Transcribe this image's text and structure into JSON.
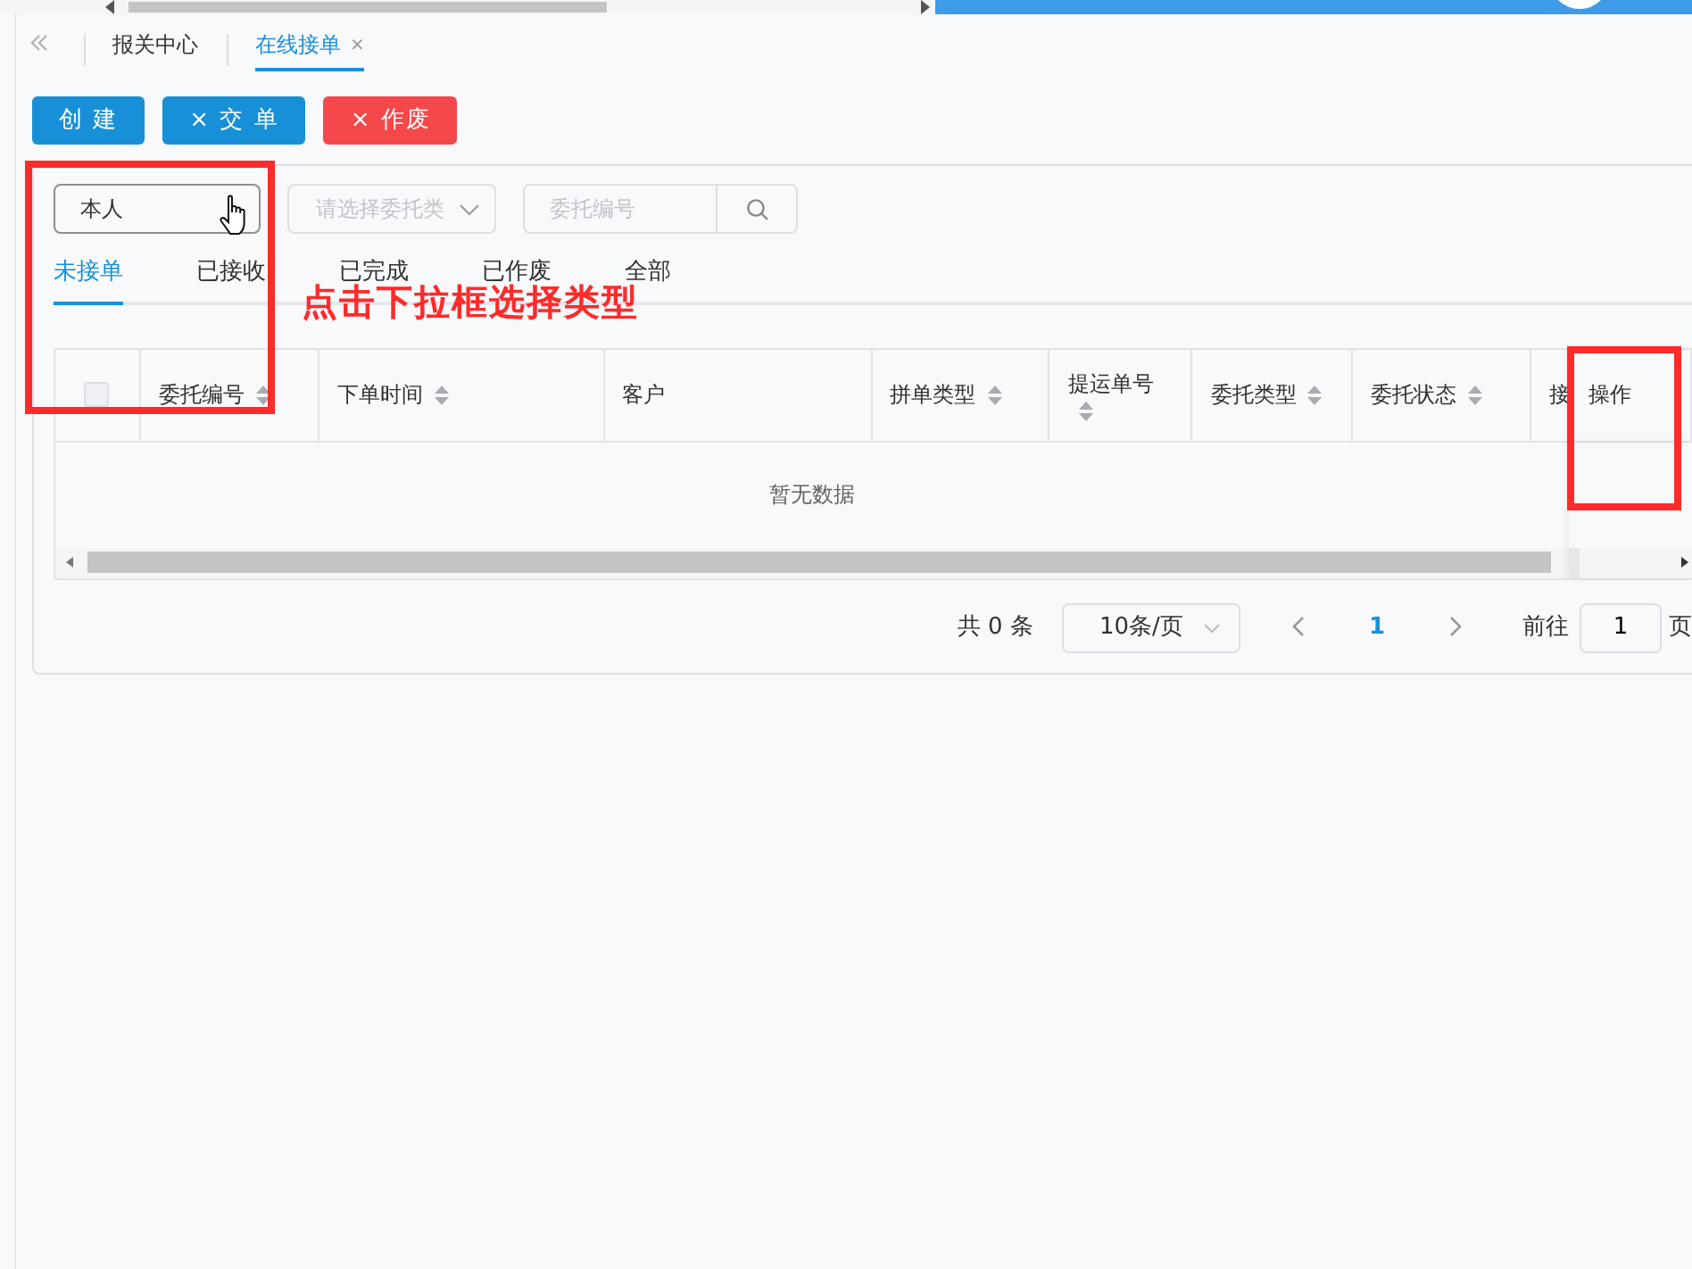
{
  "top_tabs": [
    {
      "label": "报关中心",
      "selected": false,
      "closable": false
    },
    {
      "label": "在线接单",
      "selected": true,
      "closable": true,
      "close": "×"
    }
  ],
  "actions": [
    {
      "label": "创 建",
      "kind": "primary"
    },
    {
      "label": "交 单",
      "kind": "primary",
      "icon": "×"
    },
    {
      "label": "作废",
      "kind": "danger",
      "icon": "×"
    }
  ],
  "filters": {
    "owner": {
      "value": "本人"
    },
    "type": {
      "placeholder": "请选择委托类"
    },
    "search": {
      "placeholder": "委托编号"
    }
  },
  "status_tabs": [
    {
      "label": "未接单",
      "selected": true
    },
    {
      "label": "已接收",
      "selected": false
    },
    {
      "label": "已完成",
      "selected": false
    },
    {
      "label": "已作废",
      "selected": false
    },
    {
      "label": "全部",
      "selected": false
    }
  ],
  "annotation": {
    "text": "点击下拉框选择类型"
  },
  "table": {
    "select_all": {
      "checked": false
    },
    "columns": [
      {
        "label": "委托编号",
        "sortable": true
      },
      {
        "label": "下单时间",
        "sortable": true
      },
      {
        "label": "客户",
        "sortable": false
      },
      {
        "label": "拼单类型",
        "sortable": true
      },
      {
        "label": "提运单号",
        "sortable": true
      },
      {
        "label": "委托类型",
        "sortable": true
      },
      {
        "label": "委托状态",
        "sortable": true
      },
      {
        "label": "接",
        "sortable": false
      },
      {
        "label": "操作",
        "sortable": false
      }
    ],
    "empty_text": "暂无数据"
  },
  "pagination": {
    "total": "共 0 条",
    "page_size": "10条/页",
    "pages": [
      {
        "label": "1",
        "selected": true
      }
    ],
    "goto_label": "前往",
    "goto_value": "1",
    "goto_suffix": "页"
  }
}
